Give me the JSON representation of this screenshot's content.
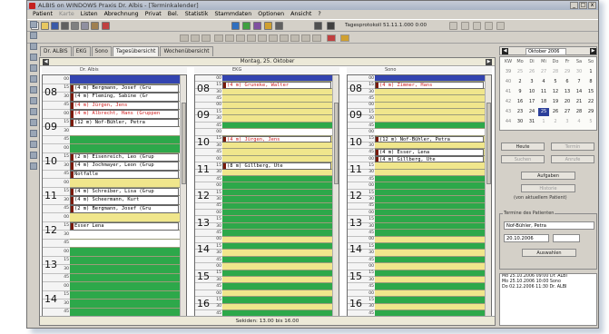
{
  "window": {
    "title": "ALBIS on WINDOWS Praxis Dr. Albis - [Terminkalender]",
    "controls": [
      "_",
      "□",
      "x"
    ]
  },
  "menu": [
    "Patient",
    "Karte",
    "Listen",
    "Abrechnung",
    "Privat",
    "Bel.",
    "Statistik",
    "Stammdaten",
    "Optionen",
    "Ansicht",
    "?"
  ],
  "toolbar": {
    "date_label": "Tagesprotokoll 51.11.1.000",
    "date_value": "0:00",
    "icons": [
      "new-doc-icon",
      "open-icon",
      "save-icon",
      "print-icon",
      "cut-icon",
      "copy-icon",
      "paste-icon",
      "patient-icon",
      "calendar-icon",
      "chart-icon",
      "lab-icon",
      "letter-icon",
      "phone-icon",
      "search-icon",
      "font-icon"
    ]
  },
  "tabs": [
    {
      "label": "Dr. ALBIS",
      "active": false
    },
    {
      "label": "EKG",
      "active": false
    },
    {
      "label": "Sono",
      "active": false
    },
    {
      "label": "Tagesübersicht",
      "active": true
    },
    {
      "label": "Wochenübersicht",
      "active": false
    }
  ],
  "calendar": {
    "date_title": "Montag, 25. Oktober",
    "status": "Sekiden: 13.00 bis 16.00",
    "columns": [
      {
        "header": "Dr. Albis"
      },
      {
        "header": "EKG"
      },
      {
        "header": "Sono"
      }
    ]
  },
  "column_hours": [
    [
      "08",
      "09",
      "10",
      "11",
      "12",
      "13",
      "14"
    ],
    [
      "08",
      "09",
      "10",
      "11",
      "12",
      "13",
      "14",
      "15",
      "16"
    ],
    [
      "08",
      "09",
      "10",
      "11",
      "12",
      "13",
      "14",
      "15",
      "16"
    ]
  ],
  "minutes": [
    "00",
    "15",
    "30",
    "45"
  ],
  "appointments": [
    [
      {
        "row": 1,
        "text": "(4 m) Bergmann, Josef  (Gru",
        "style": "blue"
      },
      {
        "row": 2,
        "text": "(4 m) Fleming, Sabine   (Gr",
        "style": "blue"
      },
      {
        "row": 3,
        "text": "(4 m) Jürgen, Jens",
        "style": "red"
      },
      {
        "row": 4,
        "text": "(4 m) Albrecht, Hans (Gruppen",
        "style": "red"
      },
      {
        "row": 5,
        "text": "(12 m) Nof-Bühler, Petra",
        "style": "blue"
      },
      {
        "row": 9,
        "text": "(2 m) Eisenreich, Leo  (Grup",
        "style": "blue"
      },
      {
        "row": 10,
        "text": "(4 m) Jochmayer, Leon (Grup",
        "style": "blue"
      },
      {
        "row": 11,
        "text": "Notfalle",
        "style": "blue"
      },
      {
        "row": 13,
        "text": "(4 m) Schreiber, Lisa  (Grup",
        "style": "blue"
      },
      {
        "row": 14,
        "text": "(4 m) Scheermann, Kurt",
        "style": "blue"
      },
      {
        "row": 15,
        "text": "(2 m) Bergmann, Josef  (Gru",
        "style": "blue"
      },
      {
        "row": 17,
        "text": "Esser Lena",
        "style": "blue"
      }
    ],
    [
      {
        "row": 1,
        "text": "(4 m) Gruneke, Walter",
        "style": "red"
      },
      {
        "row": 9,
        "text": "(4 m) Jürgen, Jens",
        "style": "red"
      },
      {
        "row": 13,
        "text": "(8 m) Gillberg, Ute",
        "style": "blue"
      }
    ],
    [
      {
        "row": 1,
        "text": "(4 m) Zimmer, Hans",
        "style": "red"
      },
      {
        "row": 9,
        "text": "(12 m) Nof-Bühler, Petra",
        "style": "blue"
      },
      {
        "row": 11,
        "text": "(4 m) Esser, Lena",
        "style": "blue"
      },
      {
        "row": 12,
        "text": "(4 m) Gillberg, Ute",
        "style": "blue"
      }
    ]
  ],
  "mini_calendar": {
    "month": "Oktober 2006",
    "weekdays": [
      "KW",
      "Mo",
      "Di",
      "Mi",
      "Do",
      "Fr",
      "Sa",
      "So"
    ],
    "weeks": [
      [
        "39",
        "25",
        "26",
        "27",
        "28",
        "29",
        "30",
        "1"
      ],
      [
        "40",
        "2",
        "3",
        "4",
        "5",
        "6",
        "7",
        "8"
      ],
      [
        "41",
        "9",
        "10",
        "11",
        "12",
        "13",
        "14",
        "15"
      ],
      [
        "42",
        "16",
        "17",
        "18",
        "19",
        "20",
        "21",
        "22"
      ],
      [
        "43",
        "23",
        "24",
        "25",
        "26",
        "27",
        "28",
        "29"
      ],
      [
        "44",
        "30",
        "31",
        "1",
        "2",
        "3",
        "4",
        "5"
      ]
    ],
    "today": "25"
  },
  "right_panel": {
    "heute_label": "Heute",
    "termin_label": "Termin",
    "suchen_label": "Suchen",
    "anrufe_label": "Anrufe",
    "aufgaben_label": "Aufgaben",
    "historie_label": "Historie",
    "historie_note": "(von aktuellem Patient)",
    "patient_section": "Termine des Patienten",
    "patient_name": "Nof-Bühler, Petra",
    "patient_date": "20.10.2006",
    "neu_button": "Auswahlen",
    "log": [
      "Mo 25.10.2006 09:00 Dr. ALBI",
      "Mo 25.10.2006 10:00 Sono",
      "Do 02.12.2006 11:30 Dr. ALBI"
    ]
  },
  "colors": {
    "slot_blue": "#3344b0",
    "slot_green": "#2da84a",
    "slot_yellow": "#f0e68c",
    "appt_marker": "#7a1a0a",
    "appt_red_text": "#cc2020"
  }
}
